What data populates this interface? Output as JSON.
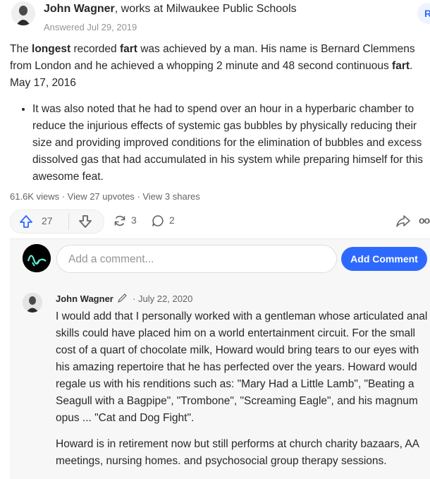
{
  "answer": {
    "author_name": "John Wagner",
    "author_credential": ", works at Milwaukee Public Schools",
    "answered_date": "Answered Jul 29, 2019",
    "top_badge": "R",
    "body_parts": [
      "The ",
      "longest",
      " recorded ",
      "fart",
      " was achieved by a man. His name is Bernard Clemmens from London and he achieved a whopping 2 minute and 48 second continuous ",
      "fart",
      ". May 17, 2016"
    ],
    "bullet": "It was also noted that he had to spend over an hour in a hyperbaric chamber to reduce the injurious effects of systemic gas bubbles by physically reducing their size and providing improved conditions for the elimination of bubbles and excess dissolved gas that had accumulated in his system while preparing himself for this awesome feat.",
    "stats": "61.6K views · View 27 upvotes · View 3 shares",
    "upvote_count": "27",
    "share_count": "3",
    "comment_count": "2",
    "more_label": "ooo"
  },
  "comment_box": {
    "placeholder": "Add a comment...",
    "button_label": "Add Comment"
  },
  "comment": {
    "author": "John Wagner",
    "date": "· July 22, 2020",
    "paragraph1": "I would add that I personally worked with a gentleman whose articulated anal skills could have placed him on a world entertainment circuit. For the small cost of a quart of chocolate milk, Howard would bring tears to our eyes with his amazing repertoire that he has perfected over the years. Howard would regale us with his renditions such as: \"Mary Had a Little Lamb\", \"Beating a Seagull with a Bagpipe\", \"Trombone\", \"Screaming Eagle\", and his magnum opus ... \"Cat and Dog Fight\".",
    "paragraph2": "Howard is in retirement now but still performs at church charity bazaars, AA meetings, nursing homes. and psychosocial group therapy sessions."
  },
  "colors": {
    "accent": "#2e69ff",
    "text": "#282829",
    "muted": "#939598",
    "panel": "#f7f7f8"
  }
}
